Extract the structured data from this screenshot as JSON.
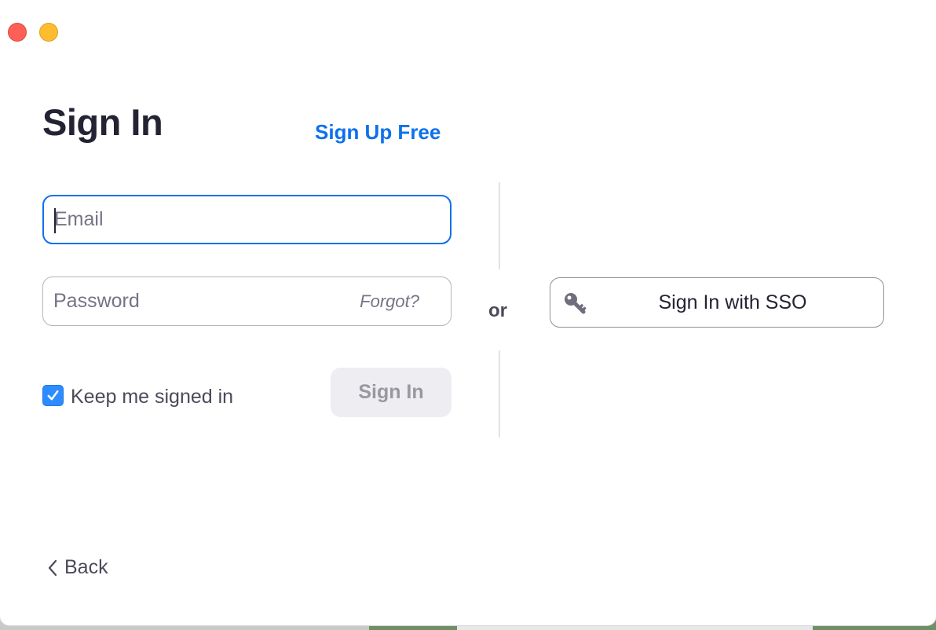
{
  "window": {
    "traffic_lights": [
      "close",
      "minimize"
    ]
  },
  "header": {
    "title": "Sign In",
    "signup_link": "Sign Up Free"
  },
  "form": {
    "email_placeholder": "Email",
    "email_value": "",
    "password_placeholder": "Password",
    "forgot_label": "Forgot?",
    "keep_signed_in_label": "Keep me signed in",
    "keep_signed_in_checked": true,
    "signin_button": "Sign In"
  },
  "separator": {
    "or_label": "or"
  },
  "sso": {
    "label": "Sign In with SSO",
    "icon": "key-icon"
  },
  "footer": {
    "back_label": "Back",
    "back_icon": "chevron-left-icon"
  },
  "colors": {
    "accent": "#0e71eb",
    "checkbox": "#2d8cff",
    "title": "#232333",
    "close": "#fe5f57",
    "minimize": "#febc2e"
  }
}
